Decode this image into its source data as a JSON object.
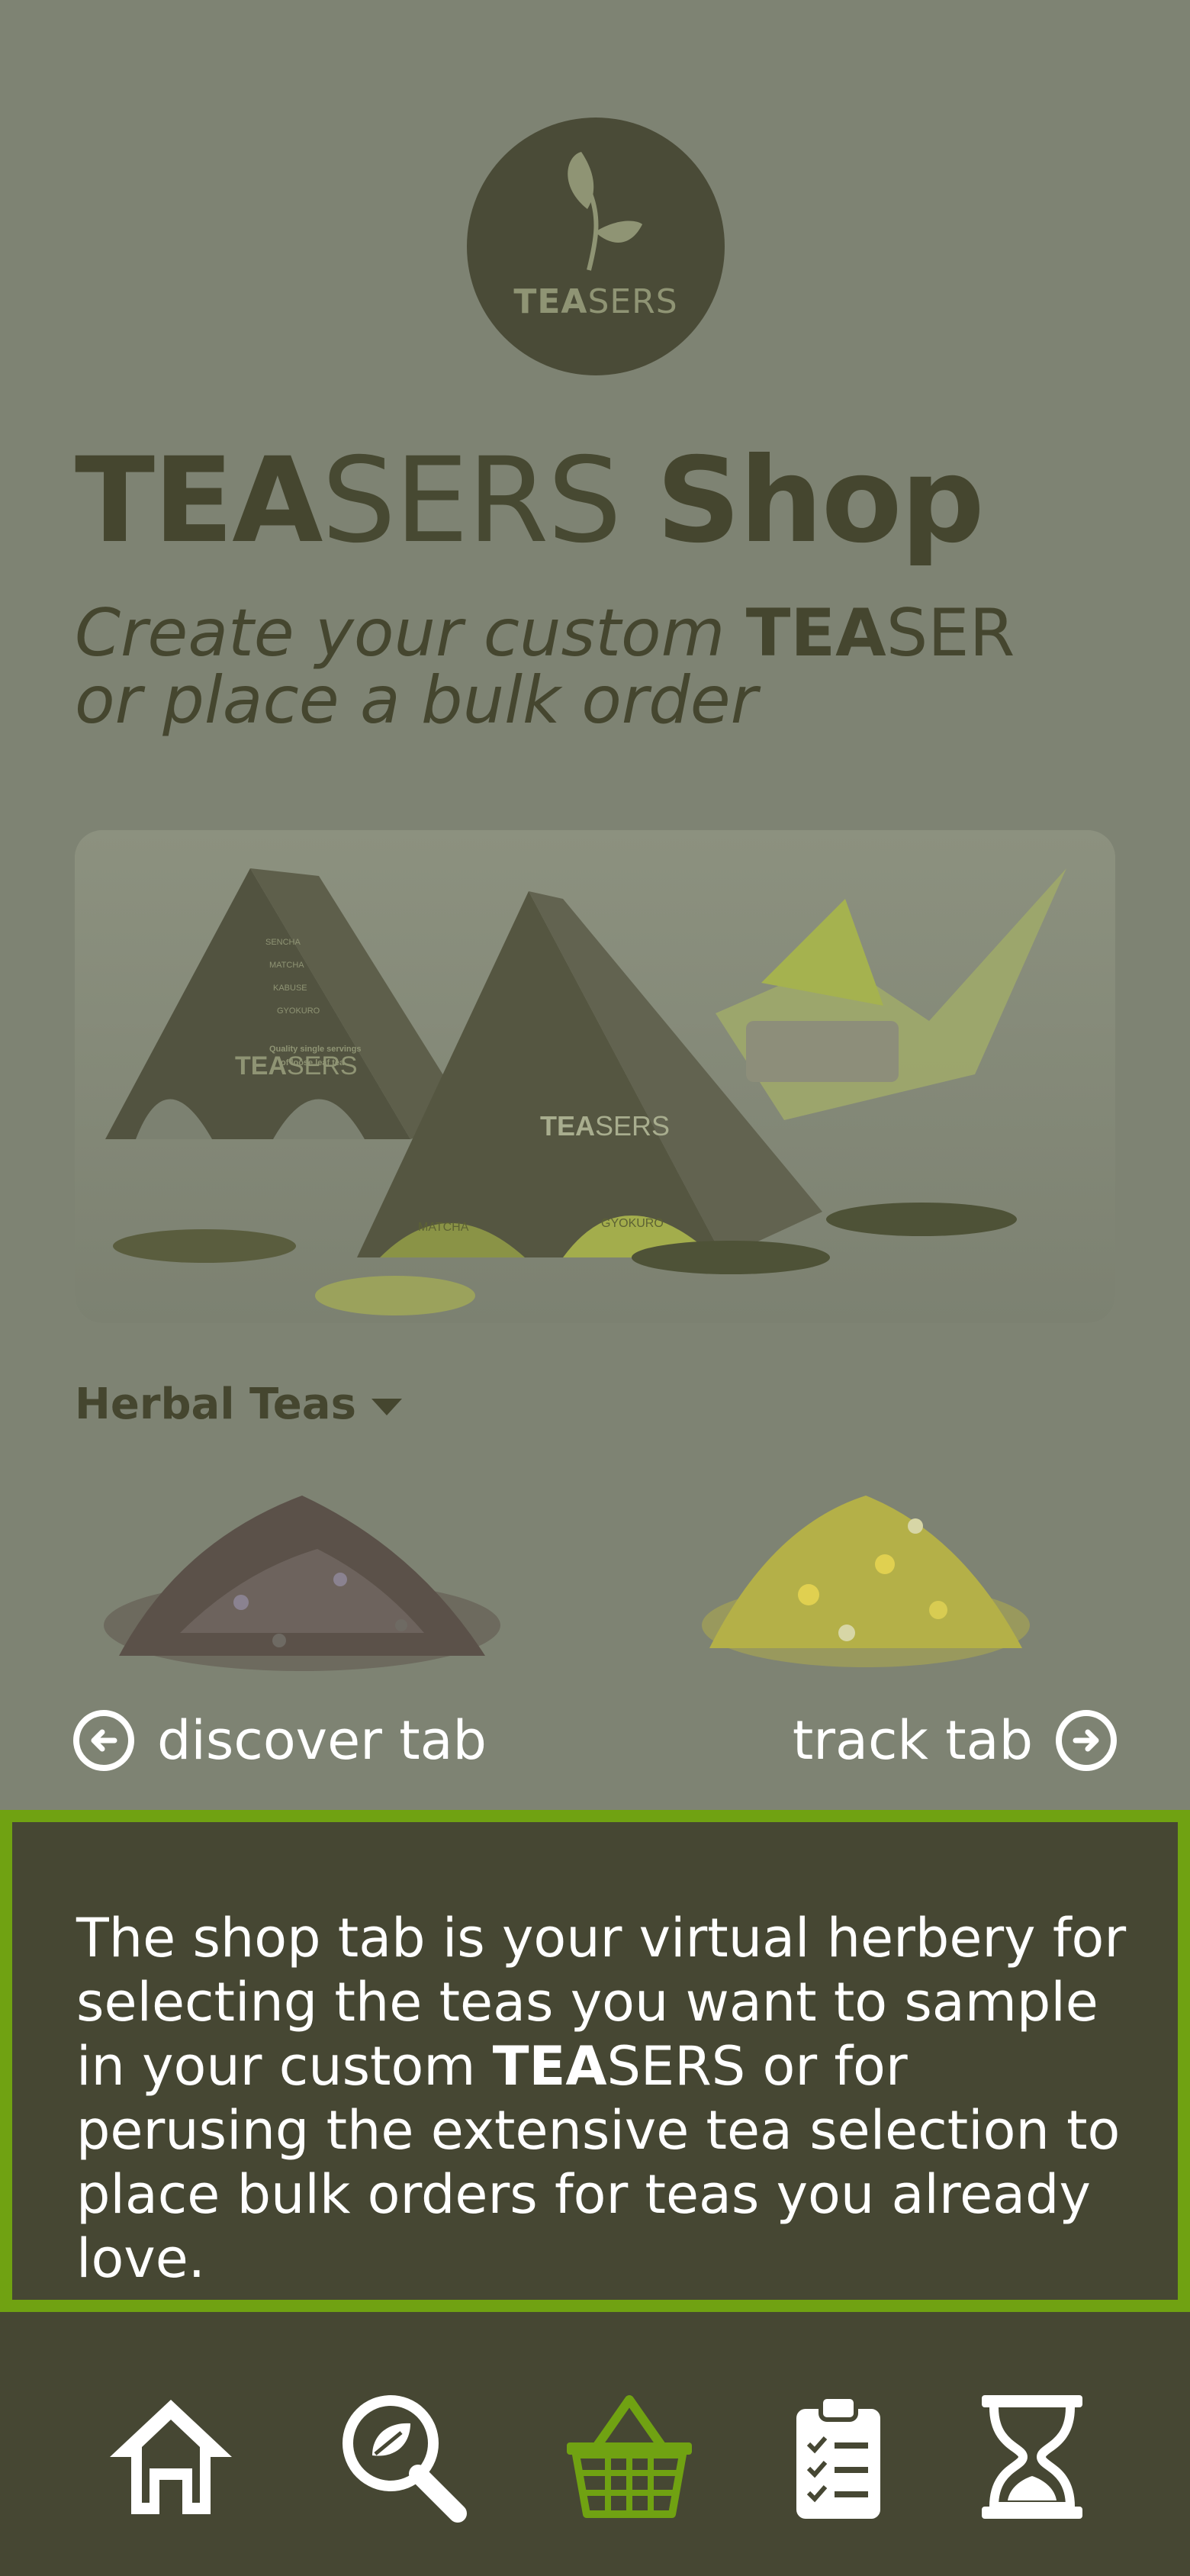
{
  "logo": {
    "brand_bold": "TEA",
    "brand_light": "SERS"
  },
  "header": {
    "title_bold": "TEA",
    "title_light": "SERS",
    "title_shop": "Shop",
    "subtitle_prefix": "Create your custom ",
    "subtitle_brand_bold": "TEA",
    "subtitle_brand_light": "SER",
    "subtitle_suffix": "or place a bulk order"
  },
  "hero": {
    "box_left_lines": [
      "SENCHA",
      "MATCHA",
      "KABUSE",
      "GYOKURO",
      "Quality single servings",
      "of loose leaf tea"
    ],
    "box_center_label": "MATCHA",
    "box_right_label": "GYOKURO",
    "box_brand_bold": "TEA",
    "box_brand_light": "SERS"
  },
  "category": {
    "selected": "Herbal Teas"
  },
  "carousel": {
    "items": [
      {
        "name": "lavender",
        "color": "#5b5149"
      },
      {
        "name": "chamomile",
        "color": "#b4b048"
      }
    ]
  },
  "nav_links": {
    "prev": "discover tab",
    "next": "track tab"
  },
  "callout": {
    "text_before": "The shop tab is your virtual herbery for selecting the teas you want to sample in your custom ",
    "brand_bold": "TEA",
    "brand_light": "SERS",
    "text_after": " or for perusing the extensive tea selection to place bulk orders for teas you already love."
  },
  "tabs": [
    {
      "icon": "home-icon",
      "active": false
    },
    {
      "icon": "search-leaf-icon",
      "active": false
    },
    {
      "icon": "basket-icon",
      "active": true
    },
    {
      "icon": "clipboard-icon",
      "active": false
    },
    {
      "icon": "hourglass-icon",
      "active": false
    }
  ],
  "colors": {
    "background": "#7e8373",
    "dark": "#464733",
    "accent": "#70a212",
    "text_dark": "#45462f"
  }
}
